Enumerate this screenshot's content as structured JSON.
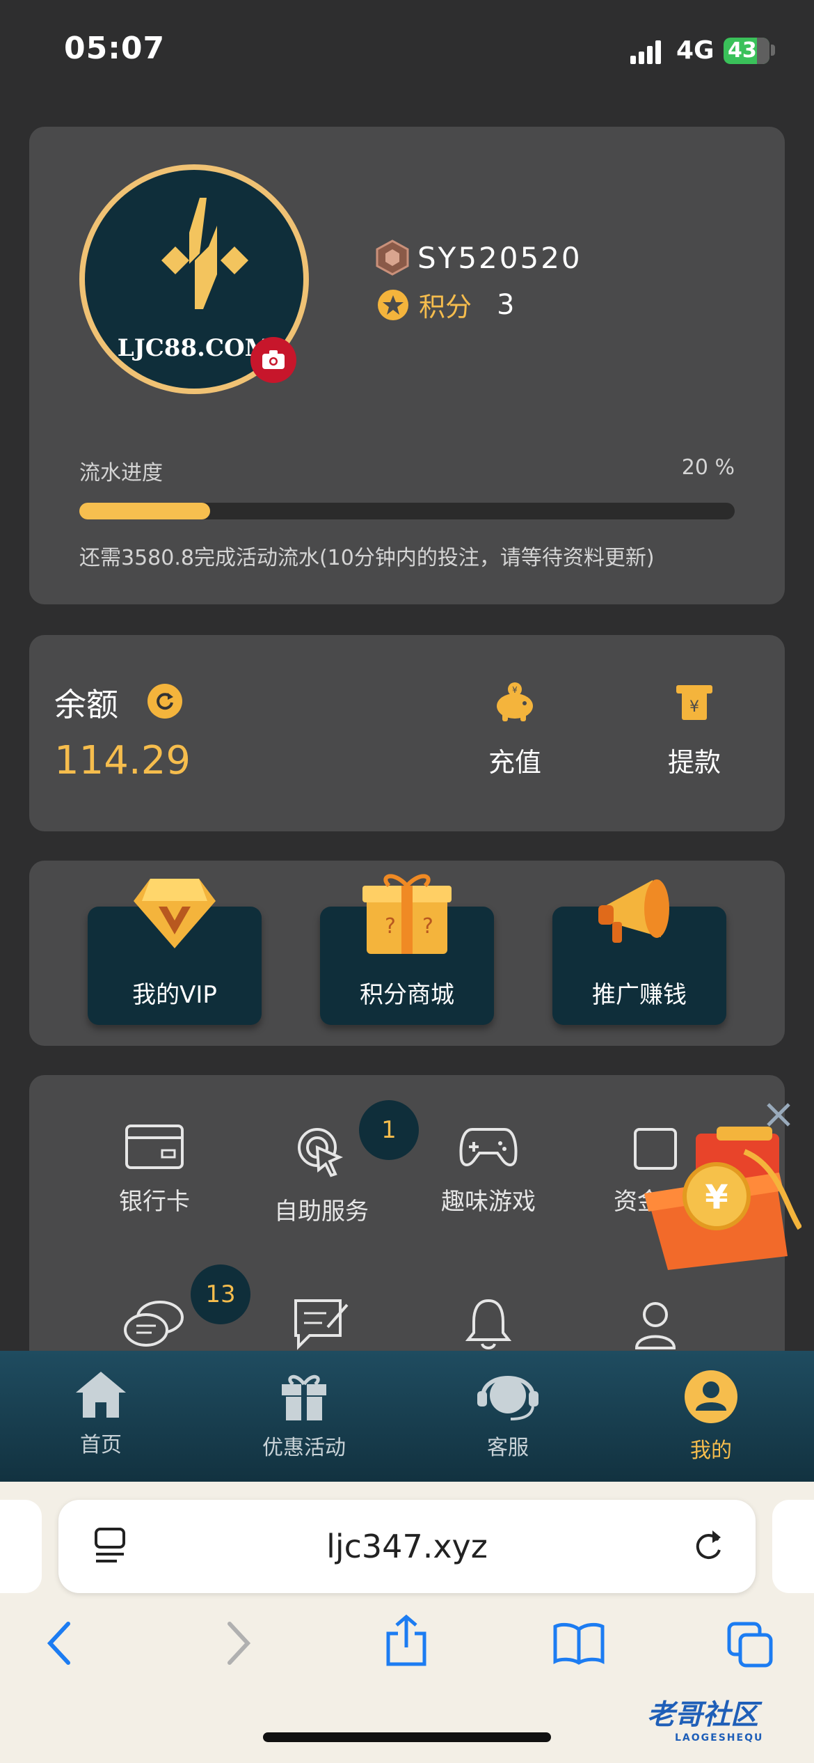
{
  "status_bar": {
    "time": "05:07",
    "network": "4G",
    "battery": "43"
  },
  "profile": {
    "avatar_text": "LJC88.COM",
    "username": "SY520520",
    "points_label": "积分",
    "points_value": "3",
    "progress_label": "流水进度",
    "progress_percent_text": "20 %",
    "progress_fraction": 0.2,
    "progress_note": "还需3580.8完成活动流水(10分钟内的投注，请等待资料更新)"
  },
  "balance": {
    "label": "余额",
    "value": "114.29",
    "deposit_label": "充值",
    "withdraw_label": "提款"
  },
  "features": [
    {
      "label": "我的VIP"
    },
    {
      "label": "积分商城"
    },
    {
      "label": "推广赚钱"
    }
  ],
  "menu": {
    "row1": [
      {
        "label": "银行卡"
      },
      {
        "label": "自助服务",
        "badge": "1"
      },
      {
        "label": "趣味游戏"
      },
      {
        "label": "资金"
      }
    ],
    "row2_badge": "13"
  },
  "tabbar": [
    {
      "label": "首页"
    },
    {
      "label": "优惠活动"
    },
    {
      "label": "客服"
    },
    {
      "label": "我的"
    }
  ],
  "browser": {
    "url": "ljc347.xyz"
  },
  "watermark": {
    "title": "老哥社区",
    "subtitle": "LAOGESHEQU"
  },
  "colors": {
    "accent": "#f6bd4d",
    "card": "#4a4a4b",
    "background": "#2e2e2f",
    "tile": "#0f2e3a"
  }
}
